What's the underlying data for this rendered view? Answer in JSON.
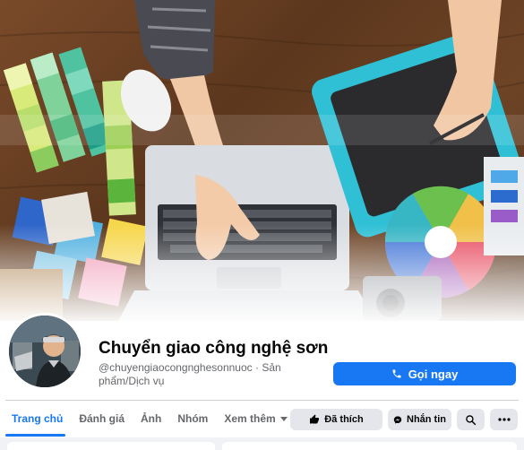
{
  "page": {
    "name": "Chuyển giao công nghệ sơn",
    "subtitle": "@chuyengiaocongnghesonnuoc · Sản phẩm/Dịch vụ",
    "call_button": "Gọi ngay"
  },
  "tabs": [
    {
      "label": "Trang chủ",
      "active": true
    },
    {
      "label": "Đánh giá",
      "active": false
    },
    {
      "label": "Ảnh",
      "active": false
    },
    {
      "label": "Nhóm",
      "active": false
    },
    {
      "label": "Xem thêm",
      "active": false,
      "dropdown": true
    }
  ],
  "actions": {
    "like_label": "Đã thích",
    "message_label": "Nhắn tin",
    "search_icon": "search-icon",
    "more_icon": "more-dots-icon"
  },
  "colors": {
    "accent": "#1877f2",
    "button_gray": "#e4e6eb",
    "secondary_text": "#65676b",
    "background": "#f0f2f5"
  }
}
